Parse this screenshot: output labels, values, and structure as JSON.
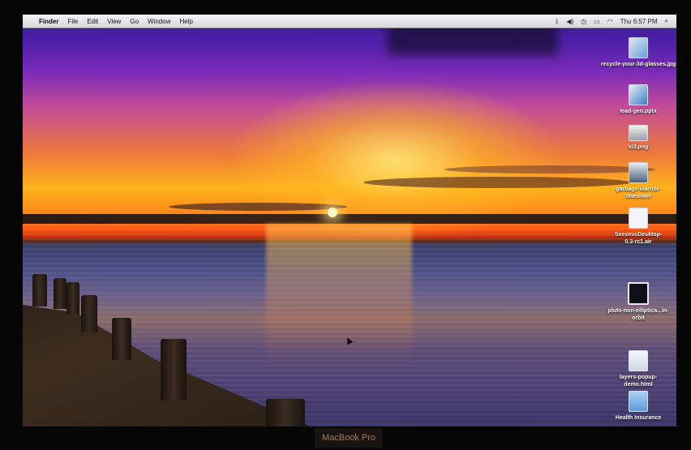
{
  "menubar": {
    "apple_glyph": "",
    "app_name": "Finder",
    "menus": [
      "File",
      "Edit",
      "View",
      "Go",
      "Window",
      "Help"
    ],
    "clock": "Thu 6:57 PM",
    "status_icons": [
      "bluetooth-icon",
      "volume-icon",
      "time-machine-icon",
      "display-icon",
      "wifi-icon",
      "spotlight-icon"
    ]
  },
  "desktop": {
    "icons": [
      {
        "label": "recycle-your-3d-glasses.jpg",
        "kind": "image-file-icon"
      },
      {
        "label": "lead-gen.pptx",
        "kind": "presentation-file-icon"
      },
      {
        "label": "sl3.png",
        "kind": "image-file-icon"
      },
      {
        "label": "garbage-warrior-onesheet",
        "kind": "image-file-icon"
      },
      {
        "label": "SeesmicDesktop-0.3-rc1.air",
        "kind": "document-file-icon"
      },
      {
        "label": "pluto-non-elliptica...in-orbit",
        "kind": "window-file-icon"
      },
      {
        "label": "layers-popup-demo.html",
        "kind": "html-file-icon"
      },
      {
        "label": "Health Insurance",
        "kind": "folder-icon"
      }
    ]
  },
  "bezel": {
    "brand": "MacBook Pro"
  }
}
